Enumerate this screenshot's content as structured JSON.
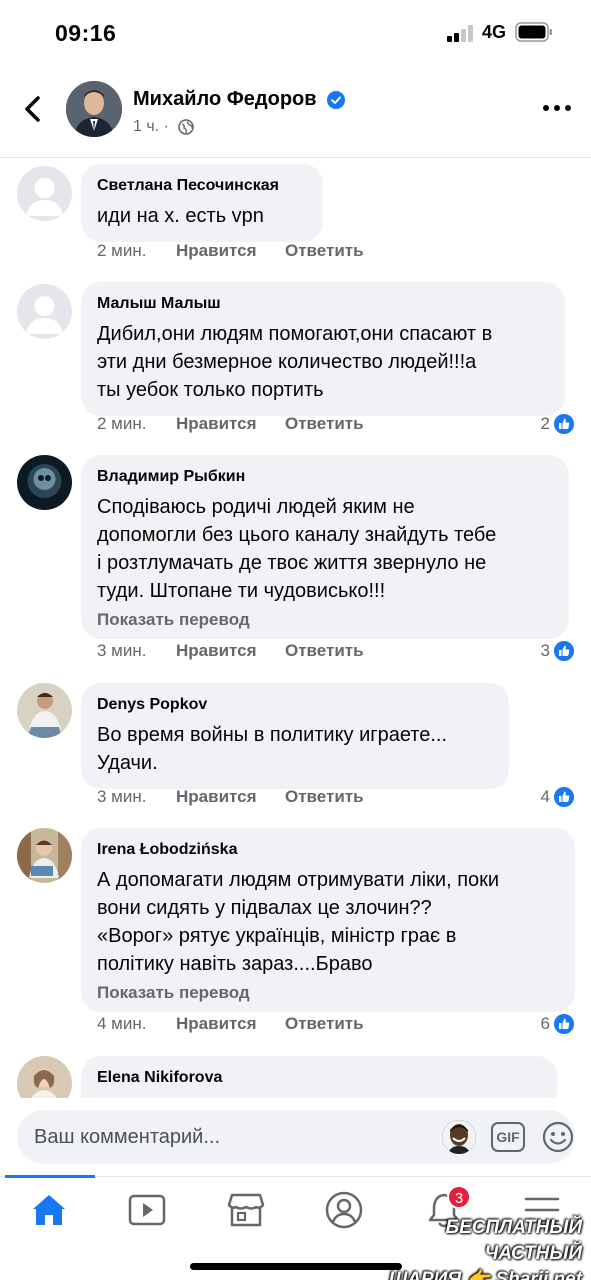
{
  "status_bar": {
    "time": "09:16",
    "network": "4G"
  },
  "header": {
    "name": "Михайло Федоров",
    "meta": "1 ч. ·",
    "back_icon": "chevron-left-icon",
    "more_icon": "more-horizontal-icon"
  },
  "comments": [
    {
      "author": "Светлана Песочинская",
      "text": "иди на х. есть vpn",
      "time": "2 мин.",
      "like": "Нравится",
      "reply": "Ответить",
      "likes": "",
      "avatar": "default"
    },
    {
      "author": "Малыш Малыш",
      "text": "Дибил,они людям помогают,они спасают в\nэти дни безмерное количество людей!!!а\nты уебок только портить",
      "time": "2 мин.",
      "like": "Нравится",
      "reply": "Ответить",
      "likes": "2",
      "avatar": "default"
    },
    {
      "author": "Владимир Рыбкин",
      "text": "Сподіваюсь родичі людей яким не\nдопомогли без цього каналу знайдуть тебе\nі розтлумачать де твоє життя звернуло не\nтуди. Штопане ти чудовисько!!!",
      "translate": "Показать перевод",
      "time": "3 мин.",
      "like": "Нравится",
      "reply": "Ответить",
      "likes": "3",
      "avatar": "dark"
    },
    {
      "author": "Denys Popkov",
      "text": "Во время войны в политику играете...\nУдачи.",
      "time": "3 мин.",
      "like": "Нравится",
      "reply": "Ответить",
      "likes": "4",
      "avatar": "photo"
    },
    {
      "author": "Irena Łobodzińska",
      "text": "А допомагати людям отримувати ліки, поки\nвони сидять у підвалах це злочин??\n«Ворог» рятує українців, міністр грає в\nполітику навіть зараз....Браво",
      "translate": "Показать перевод",
      "time": "4 мин.",
      "like": "Нравится",
      "reply": "Ответить",
      "likes": "6",
      "avatar": "photo"
    },
    {
      "author": "Elena Nikiforova",
      "avatar": "photo"
    }
  ],
  "composer": {
    "placeholder": "Ваш комментарий...",
    "gif_label": "GIF"
  },
  "tabbar": {
    "notifications_badge": "3"
  },
  "watermark": {
    "line1": "БЕСПЛАТНЫЙ ЧАСТНЫЙ",
    "line2": "ШАРИЯ 👉 Sharij.net"
  },
  "colors": {
    "accent": "#1877f2",
    "bubble": "#f0f2f5",
    "secondary_text": "#65676b",
    "badge": "#e41e3f"
  }
}
